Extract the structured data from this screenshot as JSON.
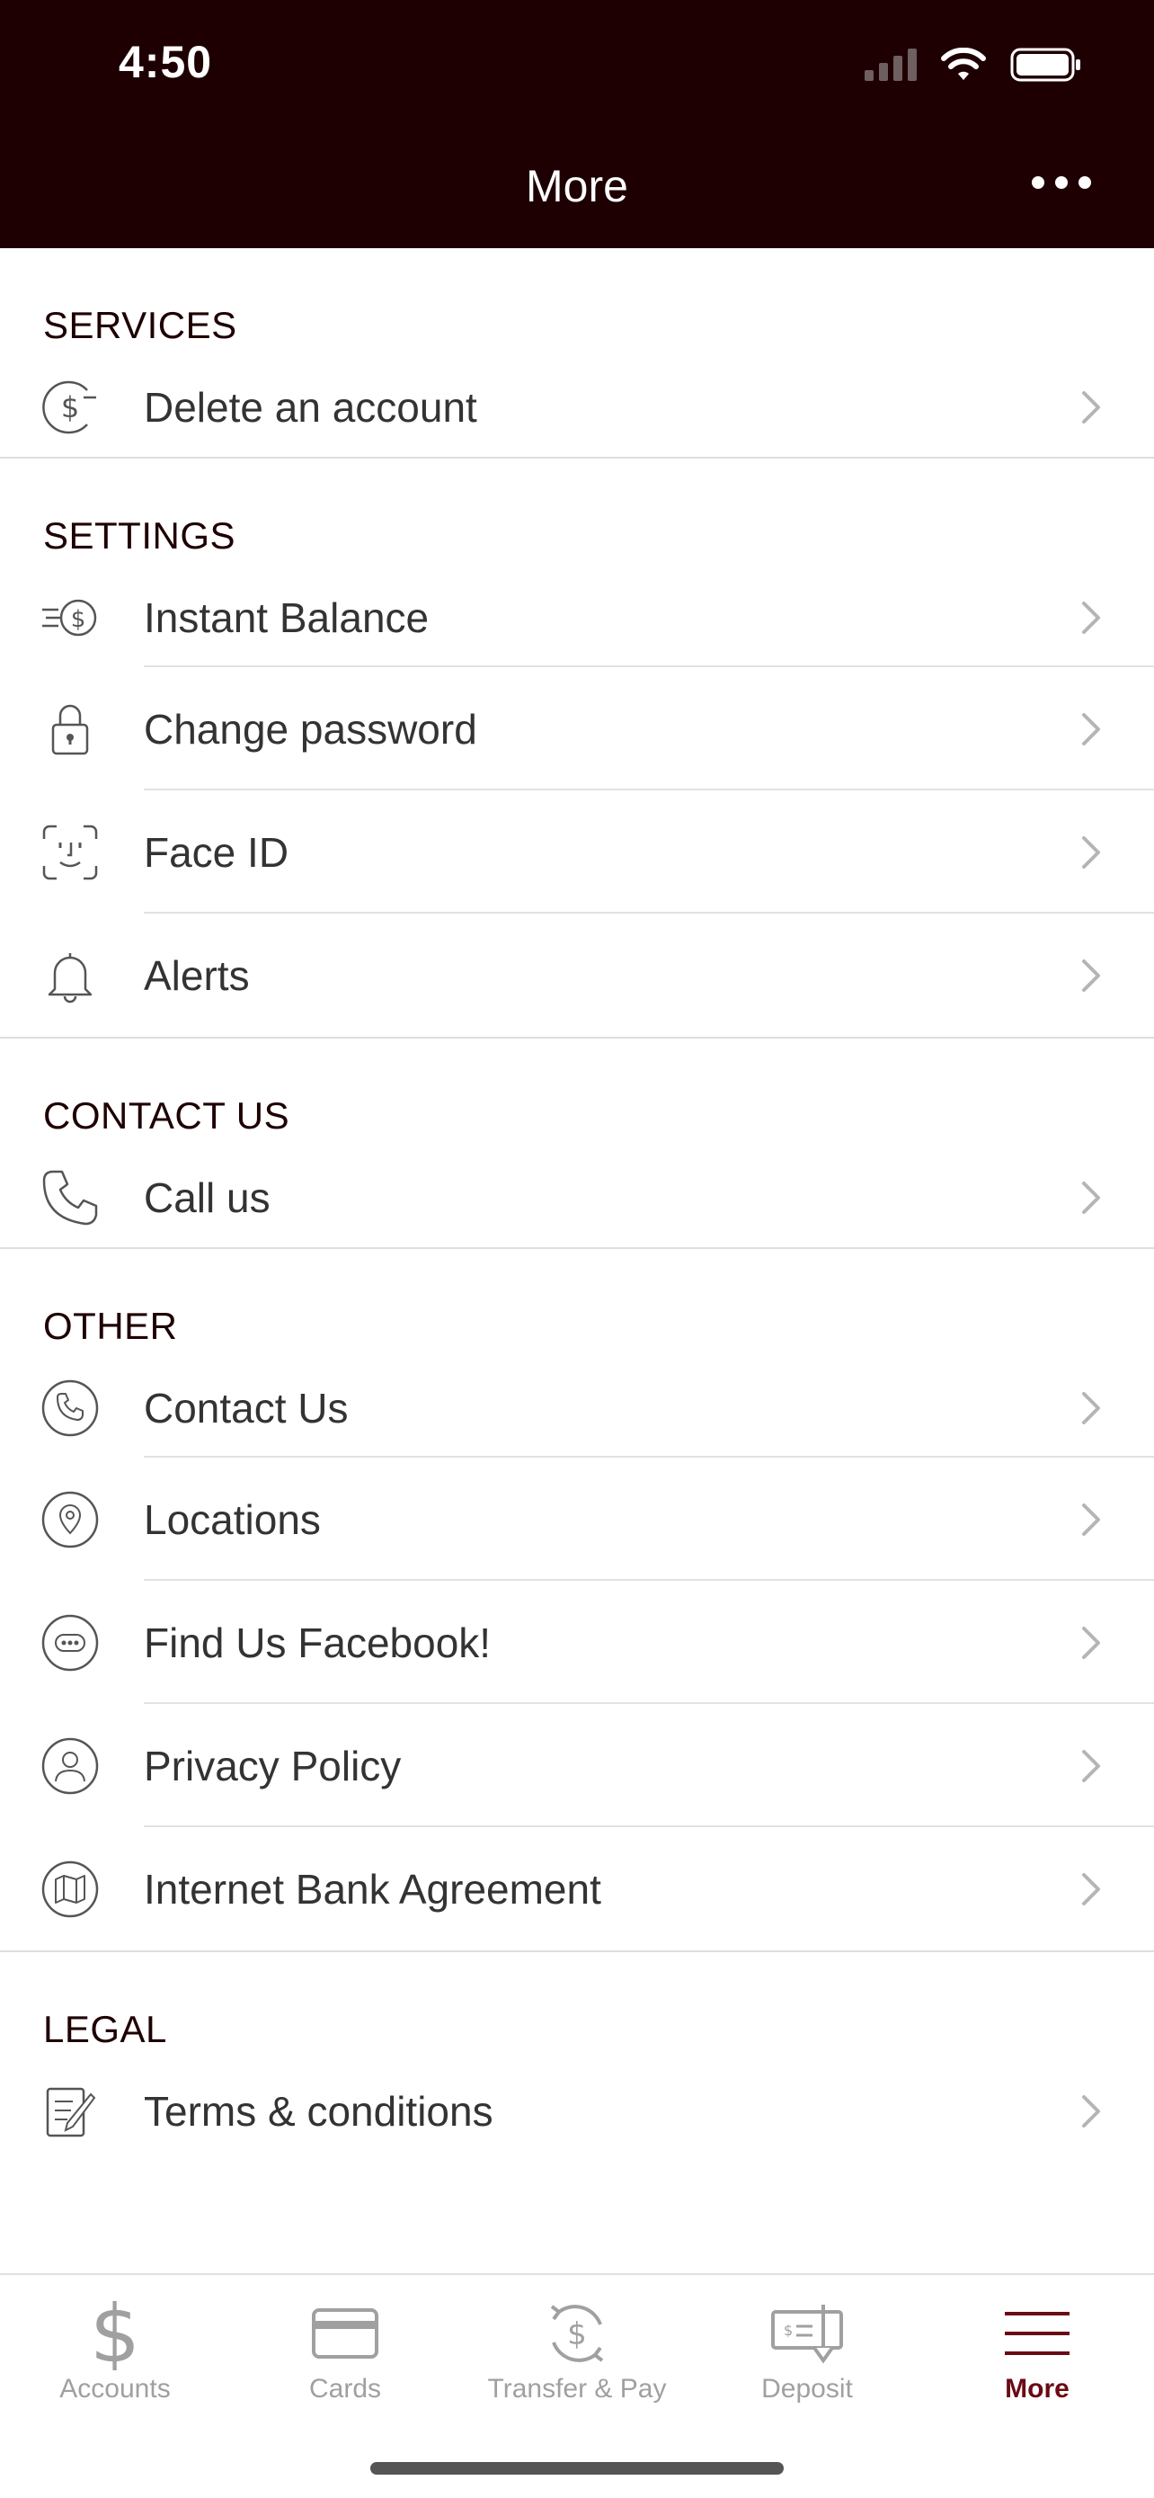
{
  "status_bar": {
    "time": "4:50"
  },
  "header": {
    "title": "More",
    "menu_icon": "ellipsis-icon"
  },
  "sections": [
    {
      "title": "SERVICES",
      "items": [
        {
          "label": "Delete an account",
          "icon": "dollar-circle-icon"
        }
      ]
    },
    {
      "title": "SETTINGS",
      "items": [
        {
          "label": "Instant Balance",
          "icon": "fast-dollar-icon"
        },
        {
          "label": "Change password",
          "icon": "lock-icon"
        },
        {
          "label": "Face ID",
          "icon": "face-id-icon"
        },
        {
          "label": "Alerts",
          "icon": "bell-icon"
        }
      ]
    },
    {
      "title": "CONTACT US",
      "items": [
        {
          "label": "Call us",
          "icon": "phone-icon"
        }
      ]
    },
    {
      "title": "OTHER",
      "items": [
        {
          "label": "Contact Us",
          "icon": "phone-circle-icon"
        },
        {
          "label": "Locations",
          "icon": "location-pin-icon"
        },
        {
          "label": "Find Us Facebook!",
          "icon": "chat-bubble-icon"
        },
        {
          "label": "Privacy Policy",
          "icon": "person-circle-icon"
        },
        {
          "label": "Internet Bank Agreement",
          "icon": "map-circle-icon"
        }
      ]
    },
    {
      "title": "LEGAL",
      "items": [
        {
          "label": "Terms & conditions",
          "icon": "document-pen-icon"
        }
      ]
    }
  ],
  "tabbar": {
    "tabs": [
      {
        "label": "Accounts",
        "icon": "dollar-icon"
      },
      {
        "label": "Cards",
        "icon": "card-icon"
      },
      {
        "label": "Transfer & Pay",
        "icon": "transfer-icon"
      },
      {
        "label": "Deposit",
        "icon": "check-deposit-icon"
      },
      {
        "label": "More",
        "icon": "hamburger-icon"
      }
    ],
    "active": "More"
  },
  "colors": {
    "header_bg": "#1f0002",
    "accent": "#6b0a14",
    "text": "#333333",
    "inactive": "#a0a0a0"
  }
}
